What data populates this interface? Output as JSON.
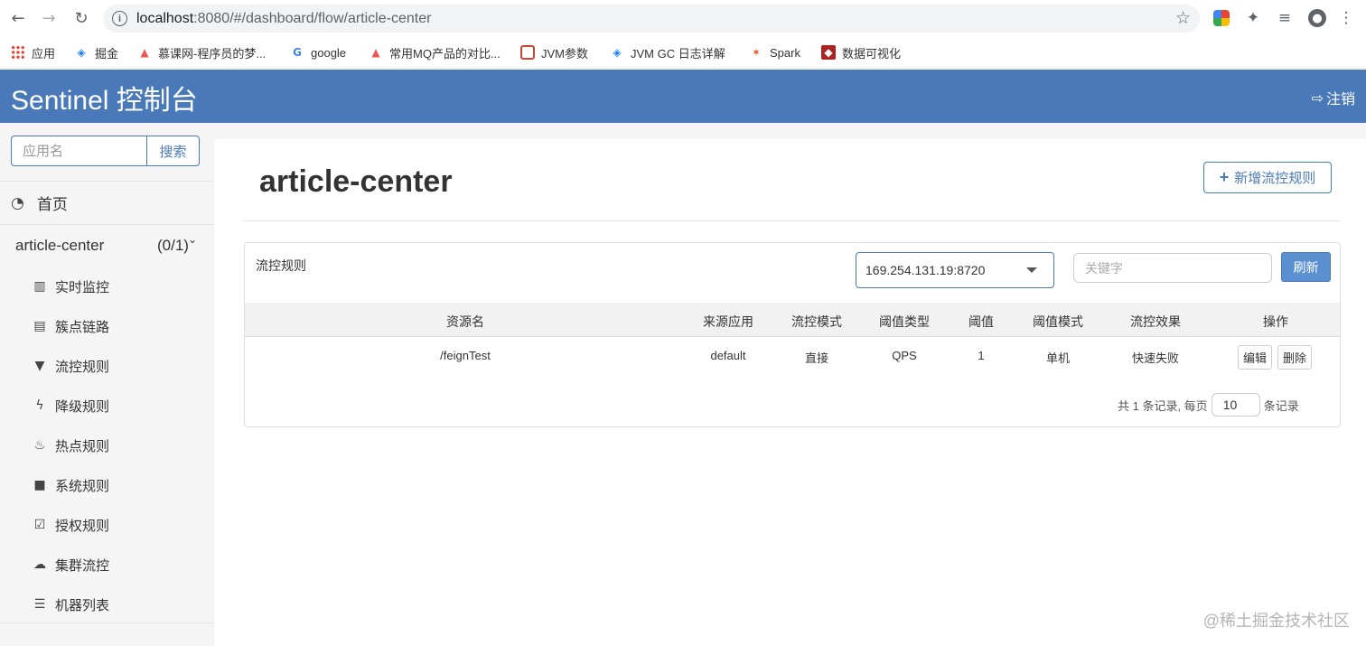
{
  "browser": {
    "url_host": "localhost",
    "url_rest": ":8080/#/dashboard/flow/article-center",
    "bookmarks": [
      "应用",
      "掘金",
      "慕课网-程序员的梦...",
      "google",
      "常用MQ产品的对比...",
      "JVM参数",
      "JVM GC 日志详解",
      "Spark",
      "数据可视化"
    ]
  },
  "header": {
    "title": "Sentinel 控制台",
    "logout": "注销"
  },
  "sidebar": {
    "search_placeholder": "应用名",
    "search_button": "搜索",
    "home": "首页",
    "app_name": "article-center",
    "app_count": "(0/1)",
    "items": [
      "实时监控",
      "簇点链路",
      "流控规则",
      "降级规则",
      "热点规则",
      "系统规则",
      "授权规则",
      "集群流控",
      "机器列表"
    ]
  },
  "main": {
    "title": "article-center",
    "add_button": "新增流控规则",
    "panel_title": "流控规则",
    "machine": "169.254.131.19:8720",
    "keyword_placeholder": "关键字",
    "refresh": "刷新",
    "columns": [
      "资源名",
      "来源应用",
      "流控模式",
      "阈值类型",
      "阈值",
      "阈值模式",
      "流控效果",
      "操作"
    ],
    "rows": [
      {
        "resource": "/feignTest",
        "limit_app": "default",
        "strategy": "直接",
        "grade": "QPS",
        "count": "1",
        "cluster_mode": "单机",
        "behavior": "快速失败",
        "edit": "编辑",
        "delete": "删除"
      }
    ],
    "pager_prefix": "共 1 条记录, 每页",
    "page_size": "10",
    "pager_suffix": "条记录"
  },
  "watermark": "@稀土掘金技术社区",
  "colors": {
    "brand": "#4979b8",
    "sidebar_bg": "#f5f5f5"
  }
}
